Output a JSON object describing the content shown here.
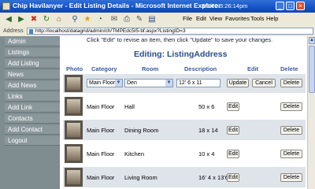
{
  "window": {
    "title": "Chip Havilanyer - Edit Listing Details - Microsoft Internet Explorer",
    "clock": "8/6/02  3:26:14pm"
  },
  "menu": [
    "File",
    "Edit",
    "View",
    "Favorites",
    "Tools",
    "Help"
  ],
  "address": {
    "label": "Address",
    "url": "http://localhost/datagrid/admin/ch/TMPEdc5I5-bf.aspx?ListingID=3"
  },
  "sidebar": {
    "items": [
      "Admin",
      "Listings",
      "Add Listing",
      "News",
      "Add News",
      "Links",
      "Add Link",
      "Contacts",
      "Add Contact",
      "Logout"
    ]
  },
  "page": {
    "hint": "Click \"Edit\" to revise an item, then click \"Update\" to save your changes.",
    "title": "Editing: ListingAddress"
  },
  "table": {
    "headers": [
      "Photo",
      "Category",
      "Room",
      "Description",
      "Edit",
      "Delete"
    ],
    "edit_row": {
      "category": "Main Floor",
      "room": "Den",
      "description": "12' 6 x 11",
      "update_label": "Update",
      "cancel_label": "Cancel",
      "delete_label": "Delete"
    },
    "rows": [
      {
        "category": "Main Floor",
        "room": "Hall",
        "description": "50 x 6",
        "edit_label": "Edit",
        "delete_label": "Delete"
      },
      {
        "category": "Main Floor",
        "room": "Dining Room",
        "description": "18 x 14",
        "edit_label": "Edit",
        "delete_label": "Delete"
      },
      {
        "category": "Main Floor",
        "room": "Kitchen",
        "description": "10 x 4",
        "edit_label": "Edit",
        "delete_label": "Delete"
      },
      {
        "category": "Main Floor",
        "room": "Living Room",
        "description": "16' 4 x 13'6",
        "edit_label": "Edit",
        "delete_label": "Delete"
      }
    ]
  },
  "icons": {
    "back": "back-arrow-icon",
    "forward": "forward-arrow-icon",
    "stop": "stop-icon",
    "refresh": "refresh-icon",
    "home": "home-icon",
    "search": "search-icon",
    "favorites": "favorites-star-icon",
    "history": "history-icon",
    "mail": "mail-icon",
    "print": "print-icon",
    "edit": "edit-icon"
  },
  "colors": {
    "titlebar": "#1552c7",
    "sidebar": "#7f8c90",
    "heading": "#2a4c8c",
    "edit_row_bg": "#dfe3ea"
  }
}
